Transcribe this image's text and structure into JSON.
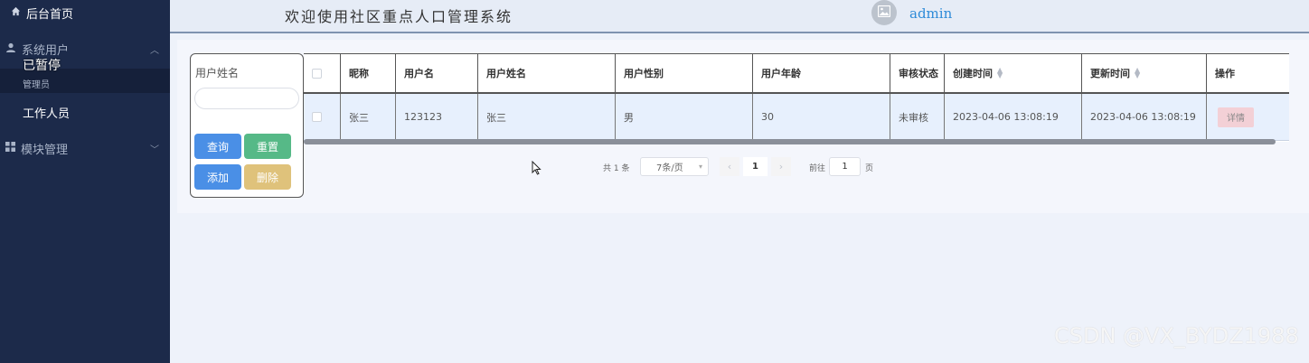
{
  "sidebar": {
    "home_label": "后台首页",
    "system_users": "系统用户",
    "paused_overlay": "已暂停",
    "admin_label": "管理员",
    "staff_label": "工作人员",
    "module_mgmt": "模块管理"
  },
  "header": {
    "title": "欢迎使用社区重点人口管理系统",
    "username": "admin"
  },
  "search": {
    "label": "用户姓名",
    "placeholder": "",
    "query_btn": "查询",
    "reset_btn": "重置",
    "add_btn": "添加",
    "delete_btn": "删除"
  },
  "table": {
    "columns": [
      "昵称",
      "用户名",
      "用户姓名",
      "用户性别",
      "用户年龄",
      "审核状态",
      "创建时间",
      "更新时间",
      "操作"
    ],
    "rows": [
      {
        "nickname": "张三",
        "username": "123123",
        "real_name": "张三",
        "gender": "男",
        "age": "30",
        "status": "未审核",
        "created": "2023-04-06 13:08:19",
        "updated": "2023-04-06 13:08:19",
        "action": "详情"
      }
    ]
  },
  "pagination": {
    "total": "共 1 条",
    "page_size": "7条/页",
    "current": "1",
    "goto_label": "前往",
    "goto_value": "1",
    "page_suffix": "页"
  },
  "watermark": "CSDN @VX_BYDZ1988",
  "colors": {
    "sidebar_bg": "#1c2a4a",
    "primary": "#4a8fe6",
    "success": "#56b987",
    "warning": "#dfc27b",
    "link": "#2e8bd8"
  }
}
